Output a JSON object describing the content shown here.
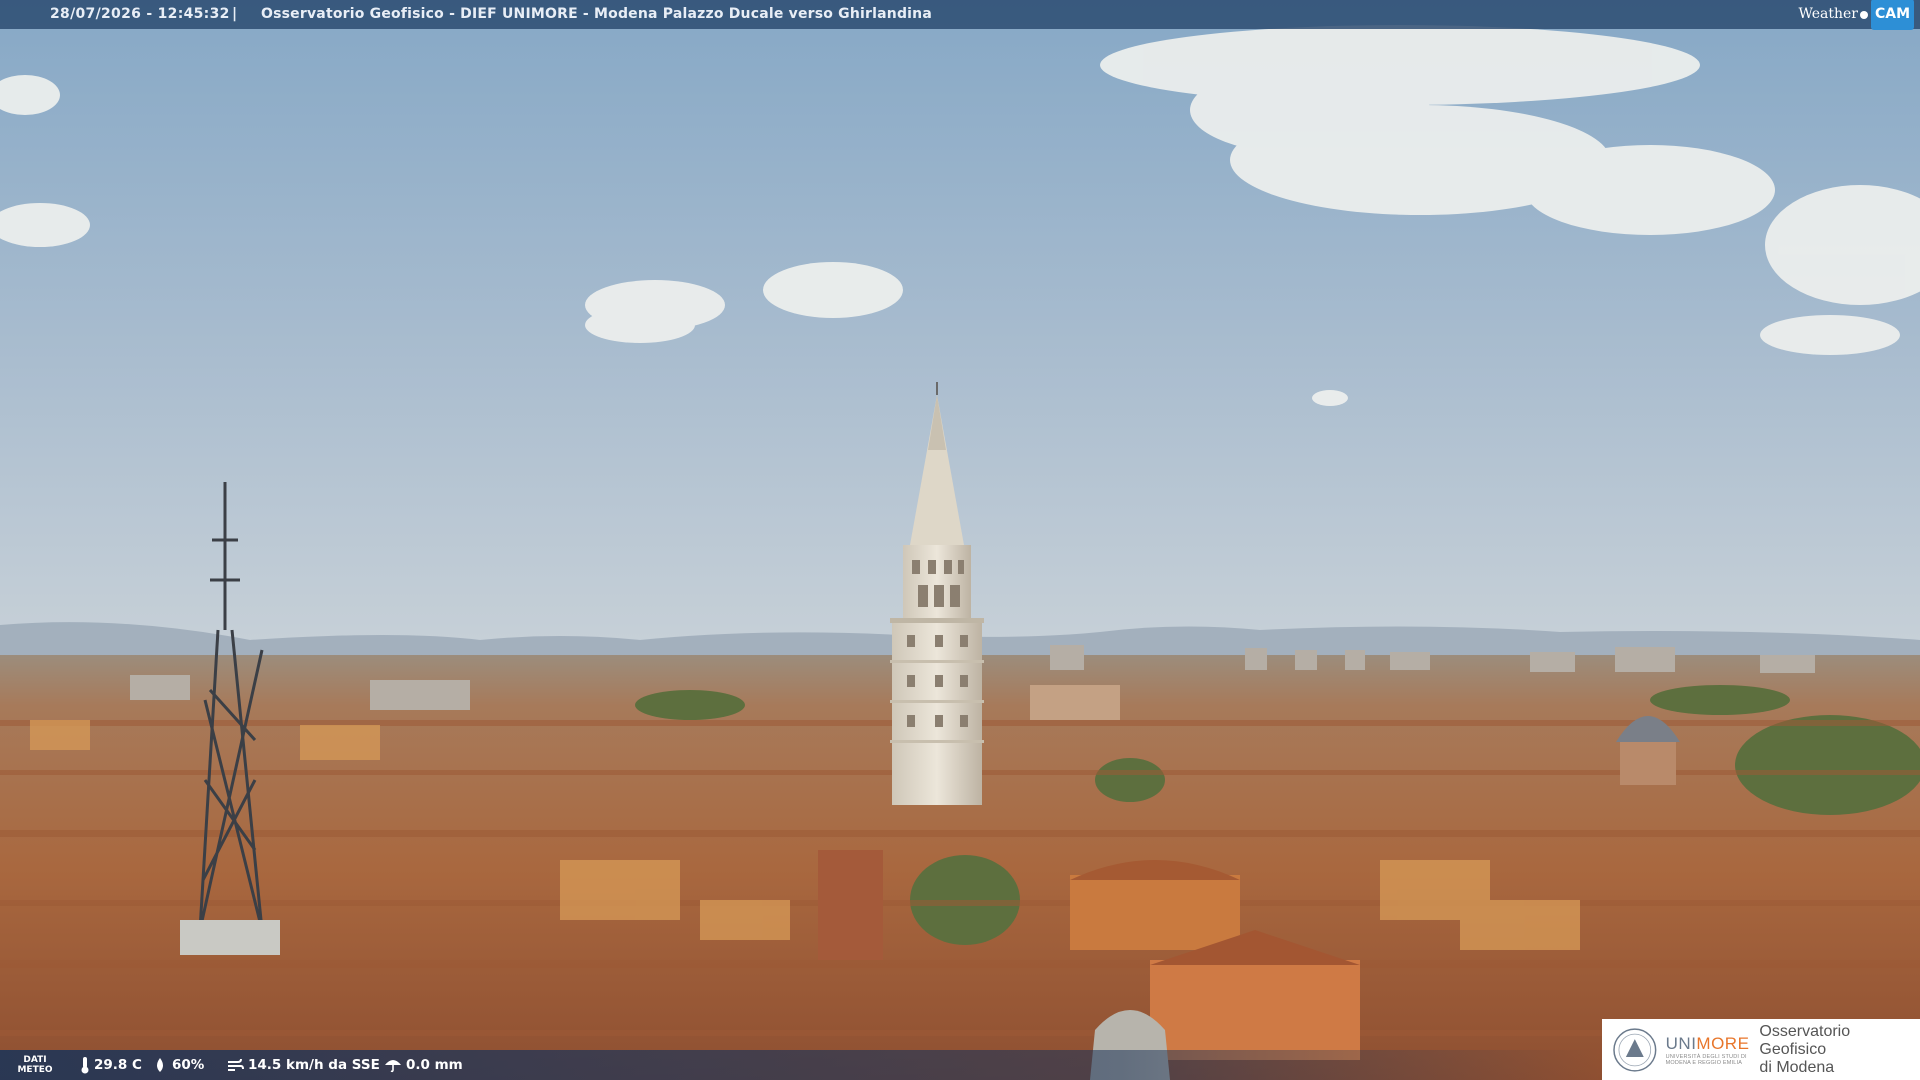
{
  "header": {
    "timestamp": "28/07/2026 - 12:45:32",
    "separator": "|",
    "title": "Osservatorio Geofisico - DIEF UNIMORE - Modena Palazzo Ducale verso Ghirlandina"
  },
  "brand": {
    "weather": "Weather",
    "cam": "CAM"
  },
  "meteo": {
    "label_line1": "DATI",
    "label_line2": "METEO",
    "temperature": "29.8 C",
    "humidity": "60%",
    "wind": "14.5 km/h da SSE",
    "rain": "0.0 mm"
  },
  "logo": {
    "name_prefix": "UNI",
    "name_highlight": "MORE",
    "sub_line1": "UNIVERSITÀ DEGLI STUDI DI",
    "sub_line2": "MODENA E REGGIO EMILIA",
    "observatory_line1": "Osservatorio Geofisico",
    "observatory_line2": "di Modena"
  },
  "colors": {
    "sky_top": "#8fb0cc",
    "sky_bottom": "#c3ced8",
    "roofs": "#b06a45",
    "tower": "#e6dfd2",
    "accent_orange": "#e8762b",
    "bar_blue": "#28486e"
  }
}
